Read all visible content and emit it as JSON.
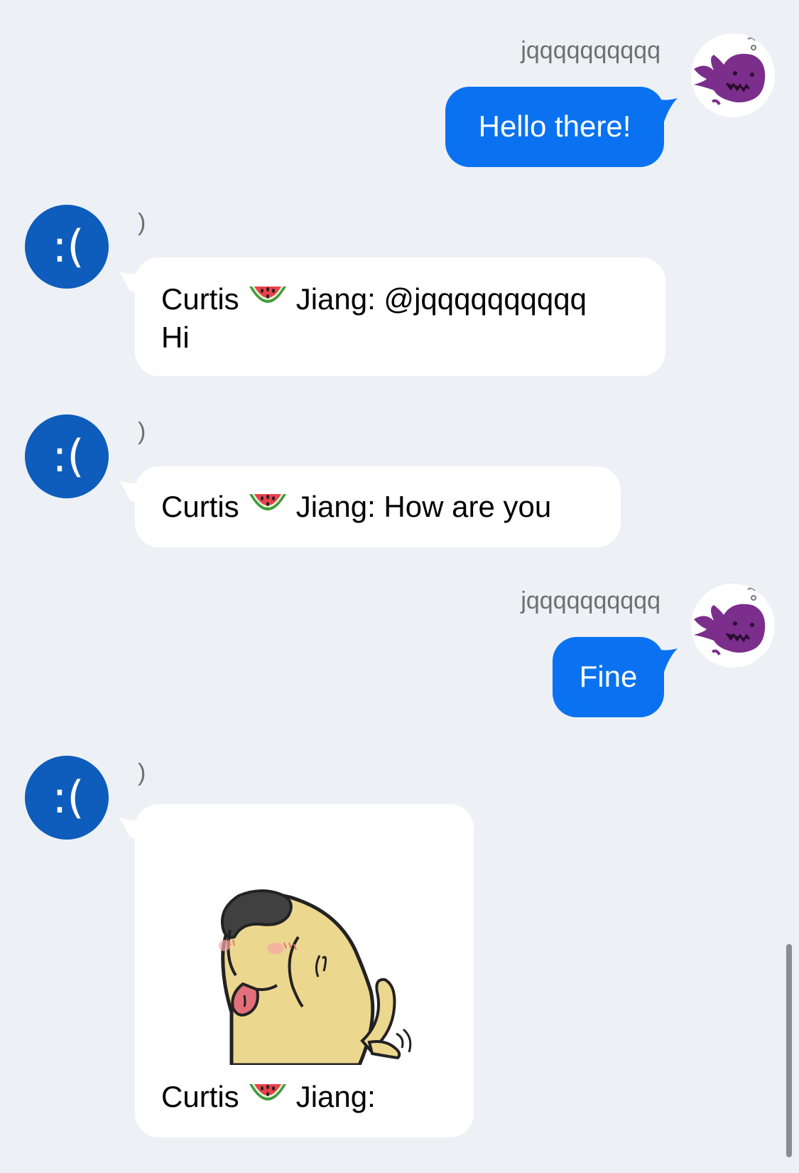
{
  "messages": [
    {
      "direction": "out",
      "sender": "jqqqqqqqqqq",
      "text": "Hello there!"
    },
    {
      "direction": "in",
      "avatar_text": ":(",
      "sender": ")",
      "text_prefix": "Curtis",
      "text_suffix": "Jiang: @jqqqqqqqqqq",
      "text_line2": "Hi"
    },
    {
      "direction": "in",
      "avatar_text": ":(",
      "sender": ")",
      "text_prefix": "Curtis",
      "text_suffix": "Jiang: How are you"
    },
    {
      "direction": "out",
      "sender": "jqqqqqqqqqq",
      "text": "Fine"
    },
    {
      "direction": "in",
      "avatar_text": ":(",
      "sender": ")",
      "text_prefix": "Curtis",
      "text_suffix": "Jiang:",
      "attachment": "dog-sticker"
    }
  ],
  "colors": {
    "background": "#edf1f5",
    "outgoing_bubble": "#0a72f0",
    "incoming_bubble": "#ffffff",
    "avatar_blue": "#0e5cbc"
  }
}
